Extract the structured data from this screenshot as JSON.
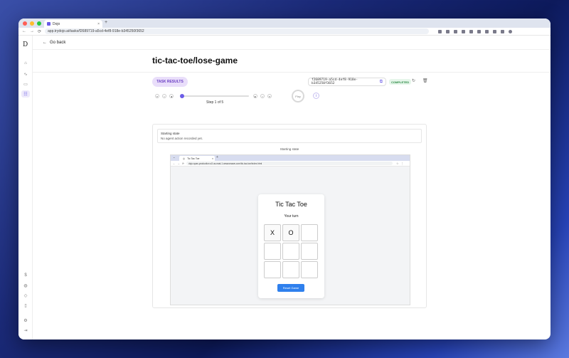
{
  "browser": {
    "tab_title": "Dojo",
    "tab_close": "×",
    "new_tab": "+",
    "url": "app.trydojo.ai/tasks/f2689719-a5cd-4ef8-918e-b345250f3652",
    "back": "←",
    "forward": "→",
    "reload": "⟳"
  },
  "sidebar": {
    "logo": "D"
  },
  "header": {
    "go_back": "Go back",
    "title": "tic-tac-toe/lose-game"
  },
  "task": {
    "results_label": "TASK RESULTS",
    "id": "f2689719-a5cd-4ef8-918e-b345250f3652",
    "status": "COMPLETED"
  },
  "player": {
    "step_label": "Step 1 of 5",
    "play_label": "Play",
    "progress_fraction": 0.0
  },
  "state": {
    "heading": "Starting state",
    "subtext": "No agent action recorded yet.",
    "screenshot_label": "Starting state"
  },
  "inner_browser": {
    "tab_title": "Tic Tac Toe",
    "url": "dojo-spas-production.s3.us-east-1.amazonaws.com/tic-tac-toe/index.html"
  },
  "game": {
    "title": "Tic Tac Toe",
    "status": "Your turn",
    "cells": [
      "X",
      "O",
      "",
      "",
      "",
      "",
      "",
      "",
      ""
    ],
    "reset_label": "Reset Game"
  },
  "colors": {
    "accent": "#6b5ce7",
    "status_green": "#2c8a45",
    "reset_blue": "#2f80ed"
  }
}
